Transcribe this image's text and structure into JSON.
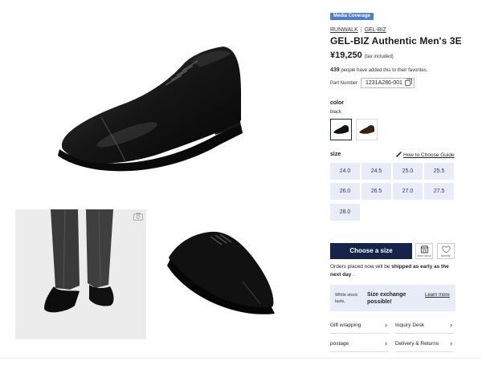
{
  "badge": "Media Coverage",
  "brand": {
    "primary": "RUNWALK",
    "separator": "|",
    "secondary": "GEL-BIZ"
  },
  "product": {
    "title": "GEL-BIZ Authentic Men's 3E",
    "price": "¥19,250",
    "tax_note": "(tax included)",
    "favorites_count": "439",
    "favorites_text": "people have added this to their favorites.",
    "part_number_label": "Part Number",
    "part_number": "1231A286-001"
  },
  "color": {
    "label": "color",
    "selected": "black",
    "swatches": [
      "black",
      "brown"
    ]
  },
  "size": {
    "label": "size",
    "guide_link": "How to Choose Guide",
    "options": [
      "24.0",
      "24.5",
      "25.0",
      "25.5",
      "26.0",
      "26.5",
      "27.0",
      "27.5",
      "28.0"
    ]
  },
  "actions": {
    "cta": "Choose a size",
    "store_caption": "store stock",
    "fav_caption": "favorite"
  },
  "shipping": {
    "prefix": "Orders placed now will be",
    "bold1": "shipped as early as the",
    "bold2": "next day",
    "suffix": "."
  },
  "exchange": {
    "left": "While stock lasts,",
    "middle": "Size exchange possible!",
    "link": "Learn more"
  },
  "links": [
    {
      "label": "Gift wrapping"
    },
    {
      "label": "Inquiry Desk"
    },
    {
      "label": "postage"
    },
    {
      "label": "Delivery & Returns"
    }
  ],
  "colors": {
    "navy": "#15244b",
    "badge": "#4a7fd0",
    "tile": "#e8ecf6"
  }
}
